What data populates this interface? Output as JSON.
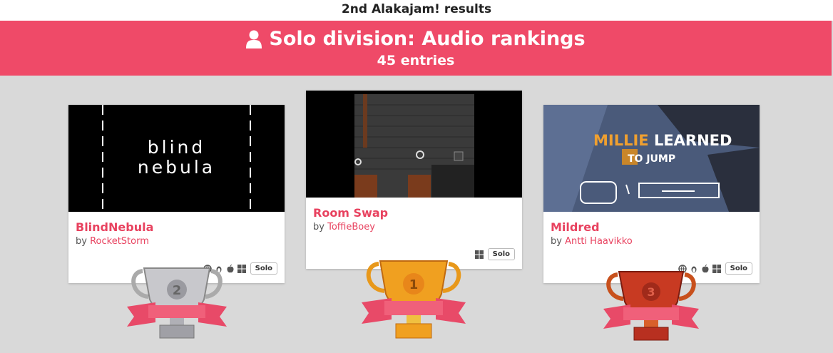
{
  "header": {
    "event_title": "2nd Alakajam! results"
  },
  "banner": {
    "title": "Solo division:  Audio rankings",
    "entries": "45 entries"
  },
  "colors": {
    "accent": "#ef4a68",
    "gold": "#f0a020",
    "silver": "#c8c8cc",
    "bronze": "#c83a22"
  },
  "entries": [
    {
      "rank": "2",
      "name": "BlindNebula",
      "by": "by",
      "author": "RocketStorm",
      "thumb_text": [
        "blind",
        "nebula"
      ],
      "platforms": [
        "web-icon",
        "linux-icon",
        "apple-icon",
        "windows-icon"
      ],
      "division": "Solo"
    },
    {
      "rank": "1",
      "name": "Room Swap",
      "by": "by",
      "author": "ToffieBoey",
      "platforms": [
        "windows-icon"
      ],
      "division": "Solo"
    },
    {
      "rank": "3",
      "name": "Mildred",
      "by": "by",
      "author": "Antti Haavikko",
      "thumb_text": [
        "MILLIE",
        "LEARNED",
        "TO JUMP"
      ],
      "platforms": [
        "web-icon",
        "linux-icon",
        "apple-icon",
        "windows-icon"
      ],
      "division": "Solo"
    }
  ]
}
